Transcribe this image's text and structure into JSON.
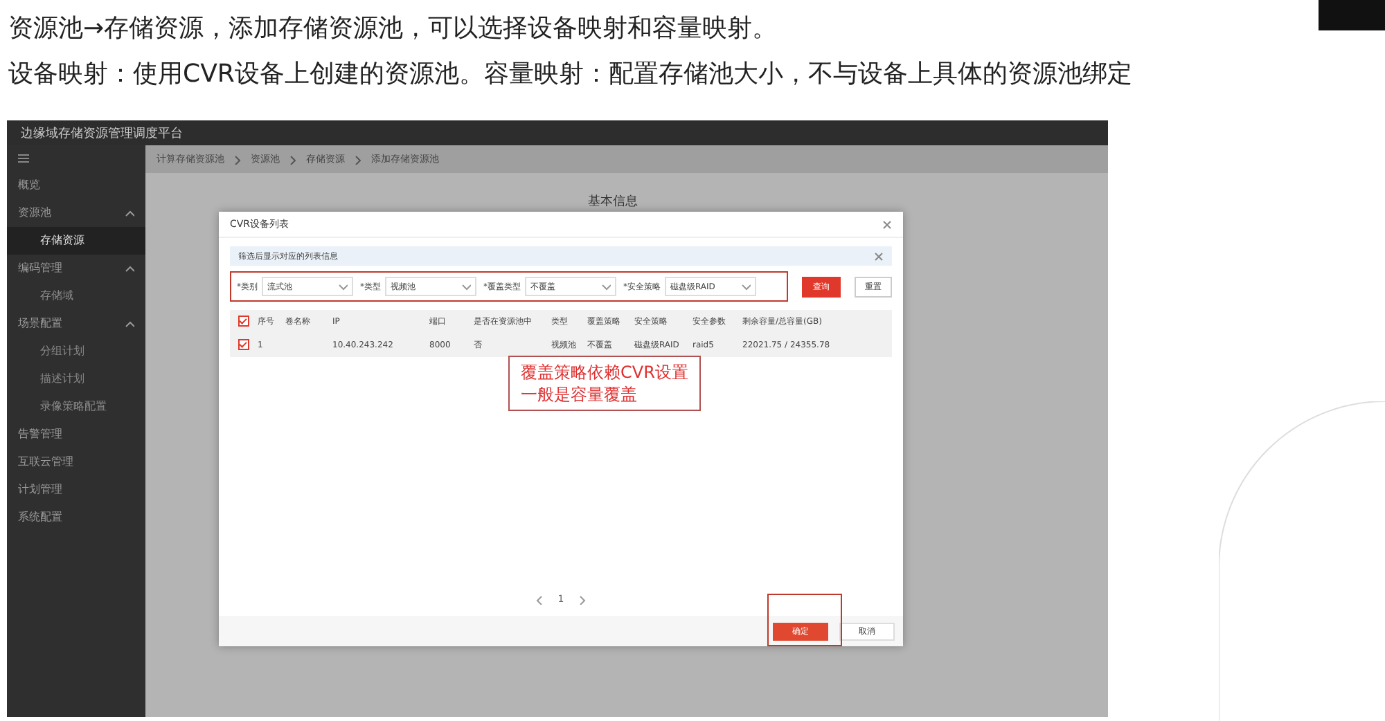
{
  "slide": {
    "lines": [
      "资源池→存储资源，添加存储资源池，可以选择设备映射和容量映射。",
      "设备映射：使用CVR设备上创建的资源池。容量映射：配置存储池大小，不与设备上具体的资源池绑定"
    ]
  },
  "app": {
    "title": "边缘域存储资源管理调度平台",
    "sidebar": {
      "items": [
        {
          "label": "概览",
          "selected": false
        },
        {
          "label": "资源池",
          "expanded": true,
          "selected": false,
          "children": [
            {
              "label": "存储资源",
              "selected": true
            }
          ]
        },
        {
          "label": "编码管理",
          "expanded": true,
          "selected": false,
          "children": [
            {
              "label": "存储域",
              "selected": false
            }
          ]
        },
        {
          "label": "场景配置",
          "expanded": true,
          "selected": false,
          "children": [
            {
              "label": "分组计划",
              "selected": false
            },
            {
              "label": "描述计划",
              "selected": false
            },
            {
              "label": "录像策略配置",
              "selected": false
            }
          ]
        },
        {
          "label": "告警管理",
          "selected": false
        },
        {
          "label": "互联云管理",
          "selected": false
        },
        {
          "label": "计划管理",
          "selected": false
        },
        {
          "label": "系统配置",
          "selected": false
        }
      ]
    },
    "breadcrumb": [
      "计算存储资源池",
      "资源池",
      "存储资源",
      "添加存储资源池"
    ],
    "section_title": "基本信息",
    "dialog": {
      "title": "CVR设备列表",
      "info": "筛选后显示对应的列表信息",
      "filters": [
        {
          "label": "*类别",
          "value": "流式池"
        },
        {
          "label": "*类型",
          "value": "视频池"
        },
        {
          "label": "*覆盖类型",
          "value": "不覆盖"
        },
        {
          "label": "*安全策略",
          "value": "磁盘级RAID"
        }
      ],
      "query_button": "查询",
      "reset_button": "重置",
      "table": {
        "all_checked": true,
        "columns": [
          "序号",
          "卷名称",
          "IP",
          "端口",
          "是否在资源池中",
          "类型",
          "覆盖策略",
          "安全策略",
          "安全参数",
          "剩余容量/总容量(GB)"
        ],
        "rows": [
          {
            "checked": true,
            "cells": [
              "1",
              "",
              "10.40.243.242",
              "8000",
              "否",
              "视频池",
              "不覆盖",
              "磁盘级RAID",
              "raid5",
              "22021.75 / 24355.78"
            ]
          }
        ]
      },
      "note": [
        "覆盖策略依赖CVR设置",
        "一般是容量覆盖"
      ],
      "page": "1",
      "ok_button": "确定",
      "cancel_button": "取消"
    }
  }
}
